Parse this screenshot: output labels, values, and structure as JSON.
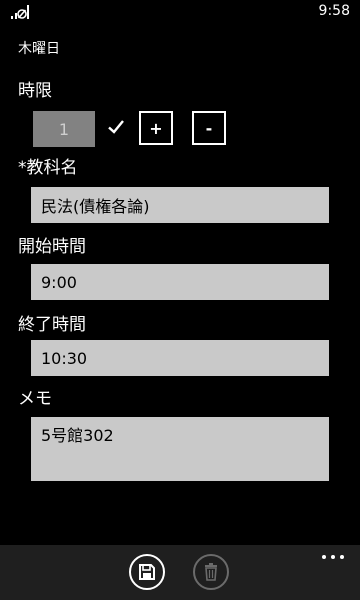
{
  "status_bar": {
    "time": "9:58"
  },
  "page": {
    "title": "木曜日"
  },
  "period": {
    "label": "時限",
    "value": "1",
    "plus_label": "+",
    "minus_label": "-"
  },
  "subject": {
    "label": "*教科名",
    "value": "民法(債権各論)"
  },
  "start": {
    "label": "開始時間",
    "value": "9:00"
  },
  "end": {
    "label": "終了時間",
    "value": "10:30"
  },
  "memo": {
    "label": "メモ",
    "value": "5号館302"
  },
  "app_bar": {
    "buttons": [
      {
        "icon": "save-icon",
        "enabled": true
      },
      {
        "icon": "delete-icon",
        "enabled": false
      }
    ],
    "more_icon": "ellipsis-icon"
  },
  "colors": {
    "background": "#000000",
    "field_bg": "#c9c9c9",
    "period_bg": "#828282",
    "app_bar_bg": "#1f1f1f",
    "disabled": "#6b6b6b"
  }
}
